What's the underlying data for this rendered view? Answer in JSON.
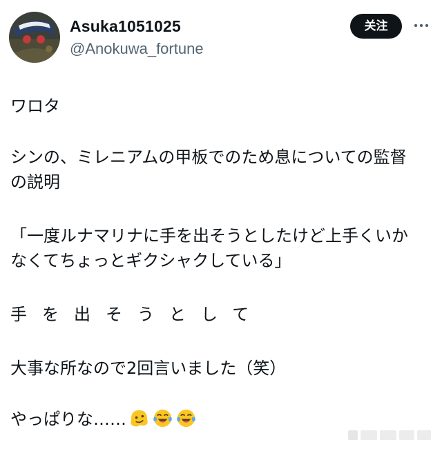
{
  "user": {
    "display_name": "Asuka1051025",
    "handle": "@Anokuwa_fortune"
  },
  "actions": {
    "follow_label": "关注",
    "more_icon": "more-dots-icon"
  },
  "tweet": {
    "paragraph_1": "ワロタ",
    "paragraph_2": "シンの、ミレニアムの甲板でのため息についての監督の説明",
    "paragraph_3": "「一度ルナマリナに手を出そうとしたけど上手くいかなくてちょっとギクシャクしている」",
    "paragraph_4": "手を出そうとして",
    "paragraph_5": "大事な所なので2回言いました（笑）",
    "paragraph_6": "やっぱりな……",
    "trailing_emojis": [
      "melting-face-icon",
      "tears-of-joy-icon",
      "tears-of-joy-icon"
    ]
  },
  "colors": {
    "text": "#0f1419",
    "secondary_text": "#536471",
    "button_bg": "#0f1419",
    "button_text": "#ffffff",
    "emoji_yellow": "#f9c623"
  }
}
